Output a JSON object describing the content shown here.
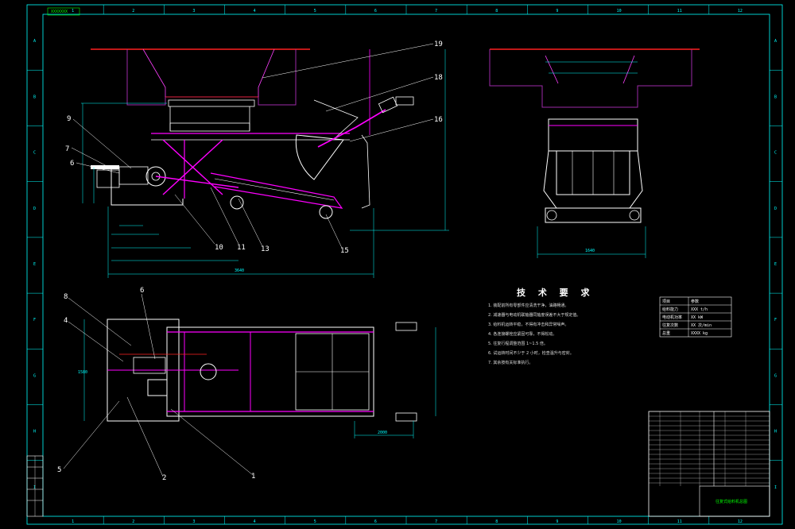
{
  "colors": {
    "background": "#000000",
    "frame": "#00ffff",
    "geometry": "#ffffff",
    "highlight": "#ff00ff",
    "hopper": "#9d2aa8",
    "red_line": "#ff2020",
    "annotation": "#00ff00"
  },
  "sheet": {
    "drawing_number": "XXXXXXX",
    "frame_columns": [
      "1",
      "2",
      "3",
      "4",
      "5",
      "6",
      "7",
      "8",
      "9",
      "10",
      "11",
      "12"
    ],
    "frame_rows": [
      "A",
      "B",
      "C",
      "D",
      "E",
      "F",
      "G",
      "H",
      "I"
    ]
  },
  "front_view": {
    "part_labels": [
      "9",
      "7",
      "6",
      "10",
      "11",
      "13",
      "15",
      "16",
      "18",
      "19"
    ],
    "overall_width_label": "3640"
  },
  "side_view": {
    "width_label": "1640"
  },
  "plan_view": {
    "part_labels": [
      "8",
      "4",
      "6",
      "5",
      "2",
      "1"
    ],
    "width_label": "2000",
    "height_label": "1580"
  },
  "technical_requirements": {
    "title": "技 术 要 求",
    "items": [
      "1. 装配前所有零部件应清洗干净，油路畅通。",
      "2. 减速器与电动机联轴器同轴度误差不大于规定值。",
      "3. 给料机运转平稳，不得有冲击和异常噪声。",
      "4. 各连接螺栓应紧固可靠，不得松动。",
      "5. 往复行程调整范围 1~1.5 倍。",
      "6. 试运转时间不少于 2 小时，检查温升与密封。",
      "7. 其余按有关标准执行。"
    ]
  },
  "parameter_table": {
    "rows": [
      [
        "项目",
        "参数"
      ],
      [
        "给料能力",
        "XXX t/h"
      ],
      [
        "电动机功率",
        "XX kW"
      ],
      [
        "往复次数",
        "XX 次/min"
      ],
      [
        "总重",
        "XXXX kg"
      ]
    ]
  },
  "title_block": {
    "title": "往复式给料机总图",
    "left_stamp_rows": [
      "",
      "",
      "",
      "",
      ""
    ]
  }
}
